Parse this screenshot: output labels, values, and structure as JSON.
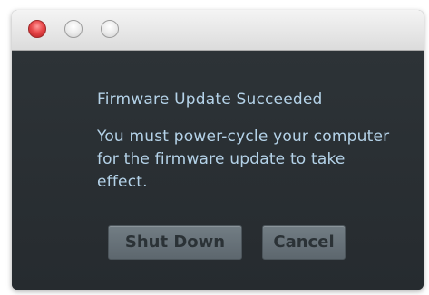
{
  "window": {
    "title_bar_buttons": [
      {
        "name": "close",
        "color": "#e8484a"
      },
      {
        "name": "minimize",
        "color": "#eaeaea"
      },
      {
        "name": "zoom",
        "color": "#eaeaea"
      }
    ]
  },
  "dialog": {
    "title": "Firmware Update Succeeded",
    "message": "You must power-cycle your computer for the firmware update to take effect.",
    "buttons": {
      "shutdown_label": "Shut Down",
      "cancel_label": "Cancel"
    }
  },
  "colors": {
    "background": "#2b3034",
    "text": "#b4d2e8",
    "button": "#6b757c"
  }
}
